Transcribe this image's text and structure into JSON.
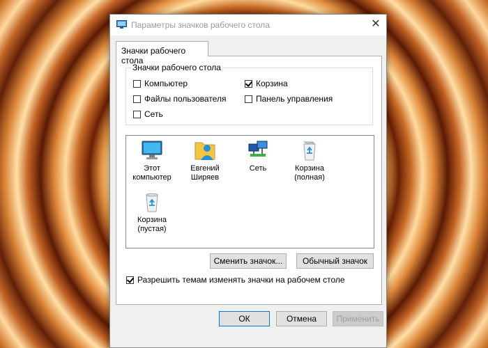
{
  "window": {
    "title": "Параметры значков рабочего стола",
    "close_glyph": "✕"
  },
  "tab": {
    "label": "Значки рабочего стола"
  },
  "group": {
    "legend": "Значки рабочего стола",
    "items": [
      {
        "label": "Компьютер",
        "checked": false
      },
      {
        "label": "Корзина",
        "checked": true
      },
      {
        "label": "Файлы пользователя",
        "checked": false
      },
      {
        "label": "Панель управления",
        "checked": false
      },
      {
        "label": "Сеть",
        "checked": false
      }
    ]
  },
  "icons": [
    {
      "label": "Этот компьютер",
      "icon": "monitor-icon",
      "selected": false
    },
    {
      "label": "Евгений Ширяев",
      "icon": "user-folder-icon",
      "selected": false
    },
    {
      "label": "Сеть",
      "icon": "network-icon",
      "selected": false
    },
    {
      "label": "Корзина (полная)",
      "icon": "recycle-bin-full-icon",
      "selected": false
    },
    {
      "label": "Корзина (пустая)",
      "icon": "recycle-bin-empty-icon",
      "selected": false
    }
  ],
  "buttons": {
    "change_icon": "Сменить значок...",
    "default_icon": "Обычный значок",
    "ok": "ОК",
    "cancel": "Отмена",
    "apply": "Применить"
  },
  "themes_checkbox": {
    "label": "Разрешить темам изменять значки на рабочем столе",
    "checked": true
  }
}
